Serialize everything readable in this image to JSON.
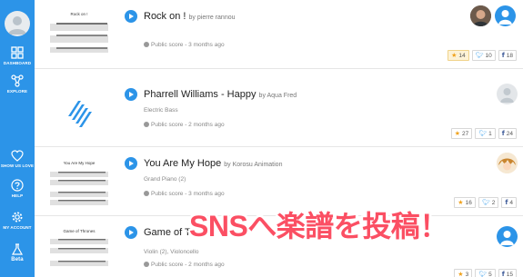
{
  "sidebar": {
    "dashboard": "DASHBOARD",
    "explore": "EXPLORE",
    "show_love": "SHOW US LOVE",
    "help": "HELP",
    "account": "MY ACCOUNT",
    "beta": "Beta"
  },
  "scores": [
    {
      "title": "Rock on !",
      "by": "by pierre rannou",
      "thumb_title": "Rock on !",
      "instrument": "",
      "meta": "Public score - 3 months ago",
      "stars": "14",
      "twitter": "10",
      "facebook": "18"
    },
    {
      "title": "Pharrell Williams - Happy",
      "by": "by Aqua Fred",
      "instrument": "Electric Bass",
      "meta": "Public score - 2 months ago",
      "stars": "27",
      "twitter": "1",
      "facebook": "24"
    },
    {
      "title": "You Are My Hope",
      "by": "by Korosu Animation",
      "thumb_title": "You Are My Hope",
      "instrument": "Grand Piano (2)",
      "meta": "Public score - 3 months ago",
      "stars": "16",
      "twitter": "2",
      "facebook": "4"
    },
    {
      "title": "Game of Th",
      "by": "",
      "thumb_title": "Game of Thrones",
      "instrument": "Violin (2), Violoncello",
      "meta": "Public score - 2 months ago",
      "stars": "3",
      "twitter": "5",
      "facebook": "15"
    }
  ],
  "banner": "SNSへ楽譜を投稿！",
  "colors": {
    "sidebar": "#2c94e8",
    "accent": "#2c94e8",
    "banner": "#fb4f63",
    "star": "#f0a21c"
  }
}
